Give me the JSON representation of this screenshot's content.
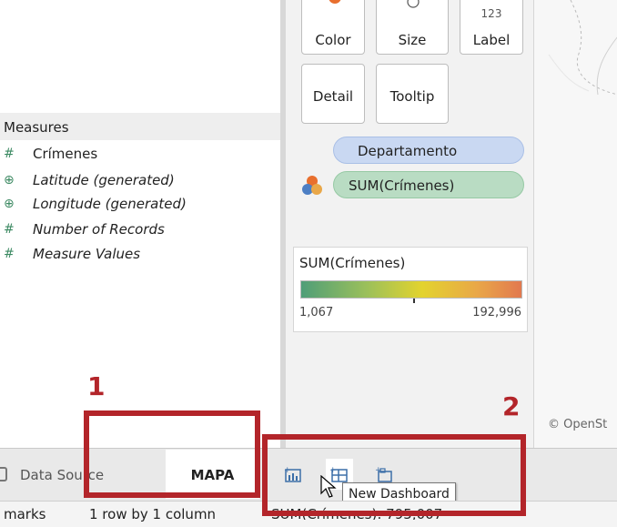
{
  "marks_card": {
    "color_label": "Color",
    "size_label": "Size",
    "label_label": "Label",
    "label_glyph": "123",
    "detail_label": "Detail",
    "tooltip_label": "Tooltip",
    "pills": [
      "Departamento",
      "SUM(Crímenes)"
    ]
  },
  "data_pane": {
    "measures_header": "Measures",
    "measures": [
      {
        "name": "Crímenes",
        "glyph": "#"
      },
      {
        "name": "Latitude (generated)",
        "glyph": "⊕"
      },
      {
        "name": "Longitude (generated)",
        "glyph": "⊕"
      },
      {
        "name": "Number of Records",
        "glyph": "#"
      },
      {
        "name": "Measure Values",
        "glyph": "#"
      }
    ]
  },
  "legend": {
    "title": "SUM(Crímenes)",
    "min": "1,067",
    "max": "192,996"
  },
  "map": {
    "credit": "© OpenSt"
  },
  "tabs": {
    "data_source": "Data Source",
    "sheet": "MAPA",
    "tooltip": "New Dashboard",
    "buttons": [
      "new-worksheet-icon",
      "new-dashboard-icon",
      "new-story-icon"
    ]
  },
  "status_bar": {
    "marks": "marks",
    "rows_columns": "1 row by 1 column",
    "sum": "SUM(Crímenes): 795,007"
  },
  "annotations": [
    "1",
    "2"
  ],
  "colors": {
    "annotation": "#b3252a",
    "pill_dimension": "#c9d8f2",
    "pill_measure": "#b9dcc3",
    "legend_low": "#4f9e78",
    "legend_high": "#e2794f"
  }
}
